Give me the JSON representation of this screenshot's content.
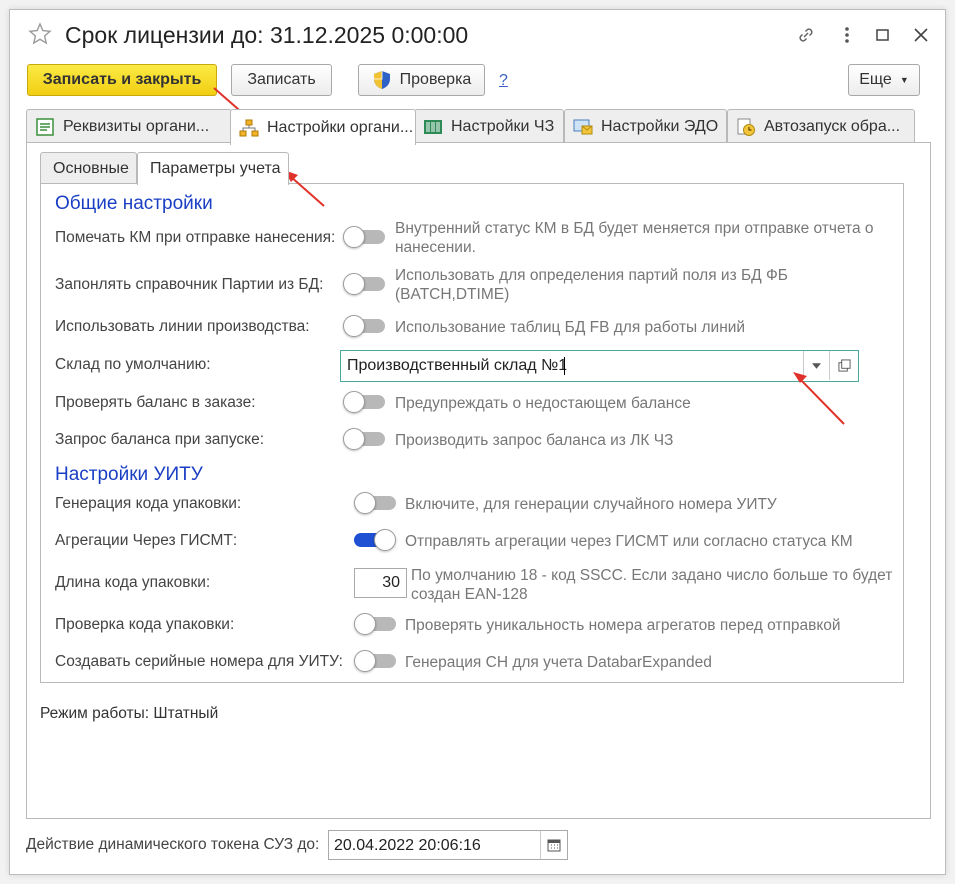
{
  "window": {
    "title": "Срок лицензии до: 31.12.2025 0:00:00"
  },
  "toolbar": {
    "save_close_label": "Записать и закрыть",
    "save_label": "Записать",
    "check_label": "Проверка",
    "help_label": "?",
    "more_label": "Еще"
  },
  "tabs": [
    {
      "label": "Реквизиты органи...",
      "icon": "document-green-icon"
    },
    {
      "label": "Настройки органи...",
      "icon": "org-structure-icon"
    },
    {
      "label": "Настройки ЧЗ",
      "icon": "barcode-green-icon"
    },
    {
      "label": "Настройки ЭДО",
      "icon": "screen-envelope-icon"
    },
    {
      "label": "Автозапуск обра...",
      "icon": "clock-document-icon"
    }
  ],
  "subtabs": [
    "Основные",
    "Параметры учета"
  ],
  "general": {
    "header": "Общие настройки",
    "rows": [
      {
        "label": "Помечать КМ при отправке нанесения:",
        "desc": "Внутренний статус КМ в БД будет меняется при отправке отчета о нанесении.",
        "on": false
      },
      {
        "label": "Запонлять справочник Партии из БД:",
        "desc": "Использовать для определения партий поля из БД ФБ (BATCH,DTIME)",
        "on": false
      },
      {
        "label": "Использовать линии производства:",
        "desc": "Использование таблиц БД FB для работы линий",
        "on": false
      },
      {
        "label": "Склад по умолчанию:",
        "value": "Производственный склад №1"
      },
      {
        "label": "Проверять баланс в заказе:",
        "desc": "Предупреждать о недостающем балансе",
        "on": false
      },
      {
        "label": "Запрос баланса при запуске:",
        "desc": "Производить запрос баланса из ЛК ЧЗ",
        "on": false
      }
    ]
  },
  "sscc": {
    "header": "Настройки УИТУ",
    "rows": [
      {
        "label": "Генерация кода упаковки:",
        "desc": "Включите, для генерации случайного номера УИТУ",
        "on": false
      },
      {
        "label": "Агрегации Через ГИСМТ:",
        "desc": "Отправлять агрегации через ГИСМТ или согласно статуса КМ",
        "on": true
      },
      {
        "label": "Длина кода упаковки:",
        "value": "30",
        "desc": "По умолчанию 18 - код SSCC. Если задано число больше то будет создан EAN-128"
      },
      {
        "label": "Проверка кода упаковки:",
        "desc": "Проверять уникальность номера агрегатов перед отправкой",
        "on": false
      },
      {
        "label": "Создавать серийные номера для УИТУ:",
        "desc": "Генерация СН для учета DatabarExpanded",
        "on": false
      }
    ]
  },
  "mode": {
    "label": "Режим работы:",
    "value": "Штатный"
  },
  "token": {
    "label": "Действие динамического токена СУЗ до:",
    "value": "20.04.2022 20:06:16"
  },
  "colors": {
    "accent_yellow": "#f5d71f",
    "section_blue": "#1a3fc4",
    "toggle_on": "#1f4fd3",
    "arrow_red": "#e0322a",
    "field_focus": "#4aa99c"
  }
}
